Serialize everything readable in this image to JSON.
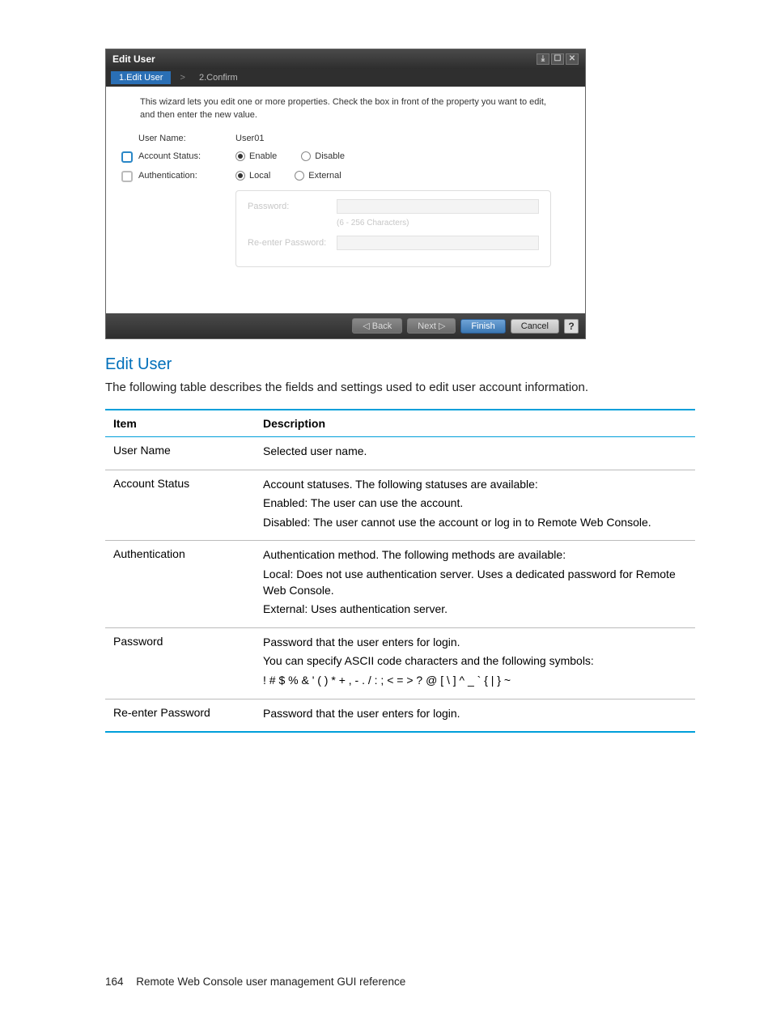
{
  "dialog": {
    "title": "Edit User",
    "crumbs": {
      "active": "1.Edit User",
      "next": "2.Confirm",
      "sep": ">"
    },
    "intro": "This wizard lets you edit one or more properties. Check the  box in front of the property you want to edit, and then enter the new value.",
    "fields": {
      "userNameLabel": "User Name:",
      "userNameValue": "User01",
      "accountStatusLabel": "Account Status:",
      "accountStatus": {
        "enable": "Enable",
        "disable": "Disable"
      },
      "authLabel": "Authentication:",
      "auth": {
        "local": "Local",
        "external": "External"
      },
      "password": {
        "label": "Password:",
        "hint": "(6 - 256 Characters)",
        "reenterLabel": "Re-enter Password:"
      }
    },
    "buttons": {
      "back": "◁ Back",
      "next": "Next ▷",
      "finish": "Finish",
      "cancel": "Cancel",
      "help": "?"
    },
    "winIcons": {
      "min": "⤓",
      "max": "☐",
      "close": "✕"
    }
  },
  "section": {
    "heading": "Edit User",
    "text": "The following table describes the fields and settings used to edit user account information."
  },
  "table": {
    "headers": {
      "item": "Item",
      "desc": "Description"
    },
    "rows": [
      {
        "item": "User Name",
        "desc": [
          "Selected user name."
        ]
      },
      {
        "item": "Account Status",
        "desc": [
          "Account statuses. The following statuses are available:",
          "Enabled: The user can use the account.",
          "Disabled: The user cannot use the account or log in to Remote Web Console."
        ]
      },
      {
        "item": "Authentication",
        "desc": [
          "Authentication method. The following methods are available:",
          "Local: Does not use authentication server. Uses a dedicated password for Remote Web Console.",
          "External: Uses authentication server."
        ]
      },
      {
        "item": "Password",
        "desc": [
          "Password that the user enters for login.",
          "You can specify ASCII code characters and the following symbols:",
          "! # $ % & ' ( ) * + , - . / : ; < = > ? @ [ \\ ] ^ _ ` { | } ~"
        ]
      },
      {
        "item": "Re-enter Password",
        "desc": [
          "Password that the user enters for login."
        ]
      }
    ]
  },
  "footer": {
    "page": "164",
    "title": "Remote Web Console user management GUI reference"
  }
}
